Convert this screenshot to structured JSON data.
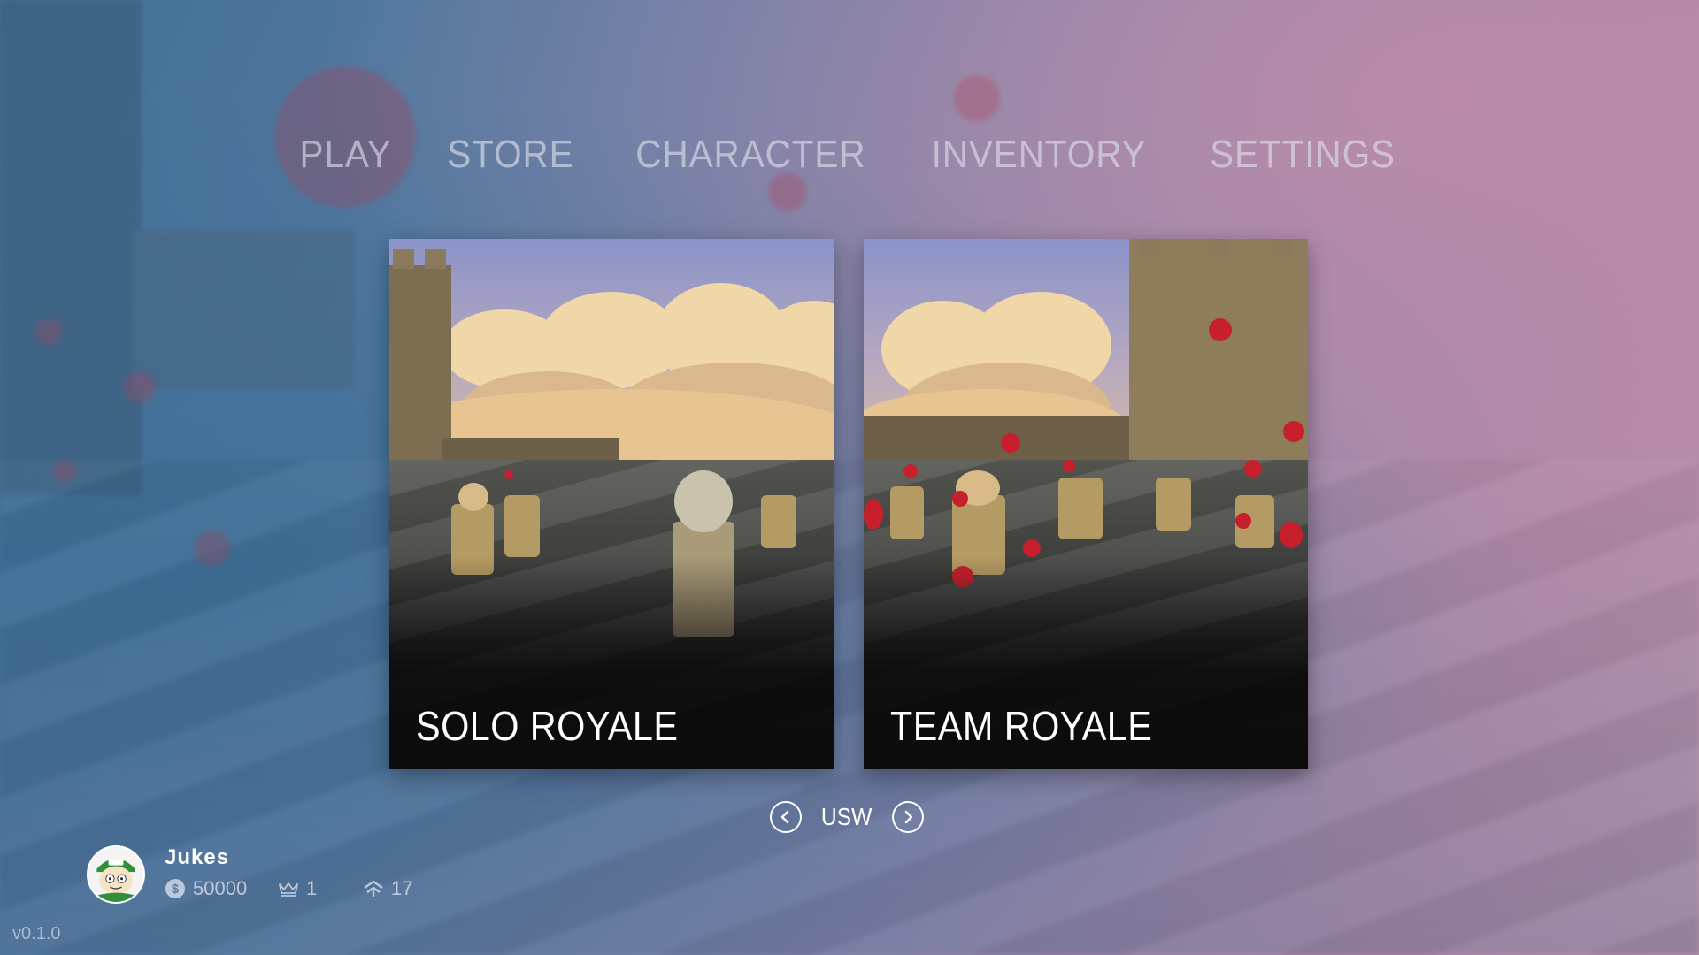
{
  "nav": {
    "items": [
      {
        "label": "PLAY"
      },
      {
        "label": "STORE"
      },
      {
        "label": "CHARACTER"
      },
      {
        "label": "INVENTORY"
      },
      {
        "label": "SETTINGS"
      }
    ]
  },
  "modes": {
    "solo": {
      "title": "SOLO ROYALE"
    },
    "team": {
      "title": "TEAM ROYALE"
    }
  },
  "region": {
    "label": "USW",
    "prev_icon": "chevron-left-circle-icon",
    "next_icon": "chevron-right-circle-icon"
  },
  "profile": {
    "name": "Jukes",
    "coins": "50000",
    "crowns": "1",
    "rank": "17",
    "coin_icon": "coin-dollar-icon",
    "crown_icon": "crown-icon",
    "rank_icon": "rank-chevron-icon"
  },
  "version": "v0.1.0",
  "colors": {
    "blood": "#c81f2c",
    "text": "#ffffff",
    "nav_text": "#e1e1eb"
  }
}
